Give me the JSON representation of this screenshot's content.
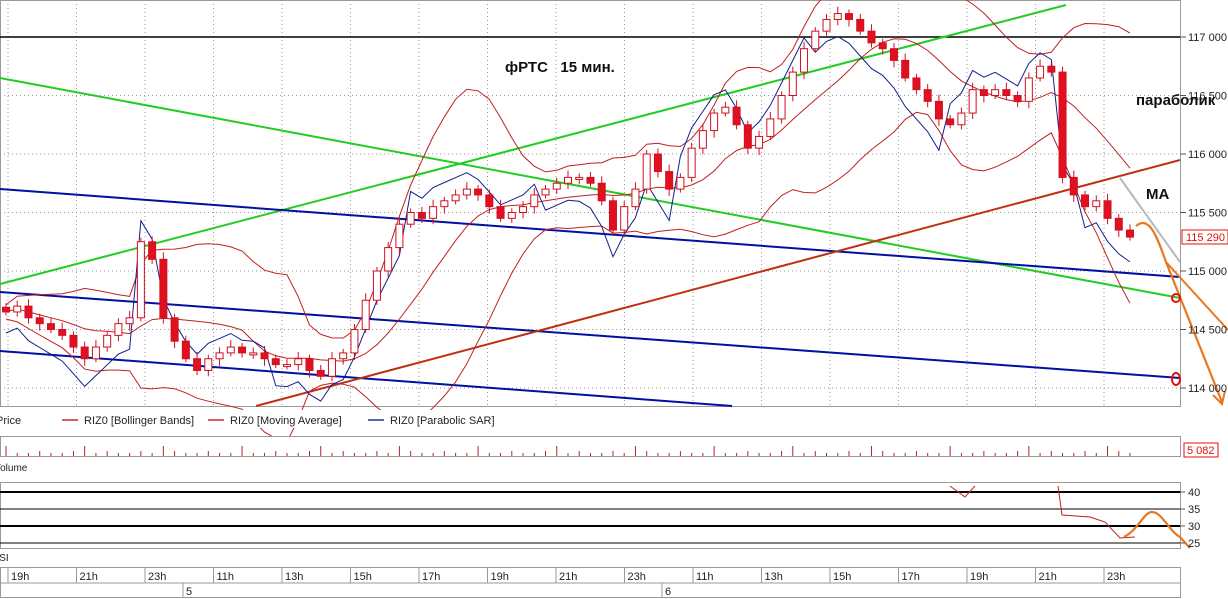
{
  "chart_data": {
    "type": "candlestick",
    "title": "фРТС   15 мин.",
    "annotations": {
      "parabolic": "параболик",
      "ma": "MA"
    },
    "price_axis": {
      "ylim": [
        113900,
        117300
      ],
      "ticks": [
        "117 000",
        "116 500",
        "116 000",
        "115 500",
        "115 000",
        "114 500",
        "114 000"
      ],
      "tick_values": [
        117000,
        116500,
        116000,
        115500,
        115000,
        114500,
        114000
      ],
      "current_price": "115 290"
    },
    "legend": [
      {
        "label": "Price"
      },
      {
        "label": "RIZ0 [Bollinger Bands]"
      },
      {
        "label": "RIZ0 [Moving Average]"
      },
      {
        "label": "RIZ0 [Parabolic SAR]"
      }
    ],
    "volume": {
      "label": "Volume",
      "current": "5 082"
    },
    "rsi": {
      "label": "RSI",
      "ticks": [
        "40",
        "35",
        "30",
        "25"
      ],
      "tick_values": [
        40,
        35,
        30,
        25
      ]
    },
    "time_axis": {
      "hours": [
        "19h",
        "21h",
        "23h",
        "11h",
        "13h",
        "15h",
        "17h",
        "19h",
        "21h",
        "23h",
        "11h",
        "13h",
        "15h",
        "17h",
        "19h",
        "21h",
        "23h"
      ],
      "days": [
        "5",
        "6"
      ]
    },
    "close_series": [
      114650,
      114700,
      114600,
      114550,
      114500,
      114450,
      114350,
      114250,
      114350,
      114450,
      114550,
      114600,
      115250,
      115100,
      114600,
      114400,
      114250,
      114150,
      114250,
      114300,
      114350,
      114300,
      114300,
      114250,
      114200,
      114200,
      114250,
      114150,
      114100,
      114250,
      114300,
      114500,
      114750,
      115000,
      115200,
      115400,
      115500,
      115450,
      115550,
      115600,
      115650,
      115700,
      115650,
      115550,
      115450,
      115500,
      115550,
      115650,
      115700,
      115750,
      115800,
      115800,
      115750,
      115600,
      115350,
      115550,
      115700,
      116000,
      115850,
      115700,
      115800,
      116050,
      116200,
      116350,
      116400,
      116250,
      116050,
      116150,
      116300,
      116500,
      116700,
      116900,
      117050,
      117150,
      117200,
      117150,
      117050,
      116950,
      116900,
      116800,
      116650,
      116550,
      116450,
      116300,
      116250,
      116350,
      116550,
      116500,
      116550,
      116500,
      116450,
      116650,
      116750,
      116700,
      115800,
      115650,
      115550,
      115600,
      115450,
      115350,
      115290
    ],
    "series_colors": {
      "up_candle": "#ffffff",
      "down_candle": "#e01020",
      "bollinger": "#c02020",
      "moving_average": "#c02020",
      "parabolic_sar": "#10208c",
      "green_trendline": "#22cc22",
      "blue_trendline": "#0010a0",
      "red_trendline": "#c03010",
      "forecast": "#e87722"
    }
  }
}
